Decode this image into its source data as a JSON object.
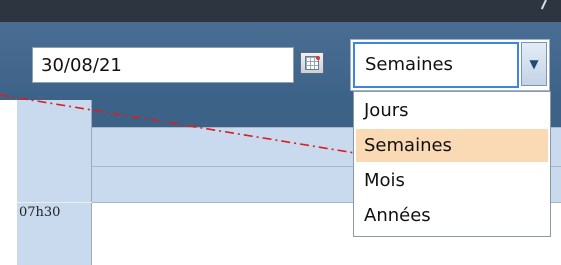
{
  "date_picker": {
    "value": "30/08/21",
    "calendar_icon": "calendar-icon"
  },
  "view_select": {
    "selected": "Semaines",
    "arrow_icon": "chevron-down-icon",
    "options": [
      "Jours",
      "Semaines",
      "Mois",
      "Années"
    ]
  },
  "schedule": {
    "first_time_slot": "07h30"
  },
  "colors": {
    "toolbar": "#3d6288",
    "selected_option": "#fad9b5",
    "annotation_line": "#d8201e",
    "grid_header": "#c9d9ee"
  }
}
